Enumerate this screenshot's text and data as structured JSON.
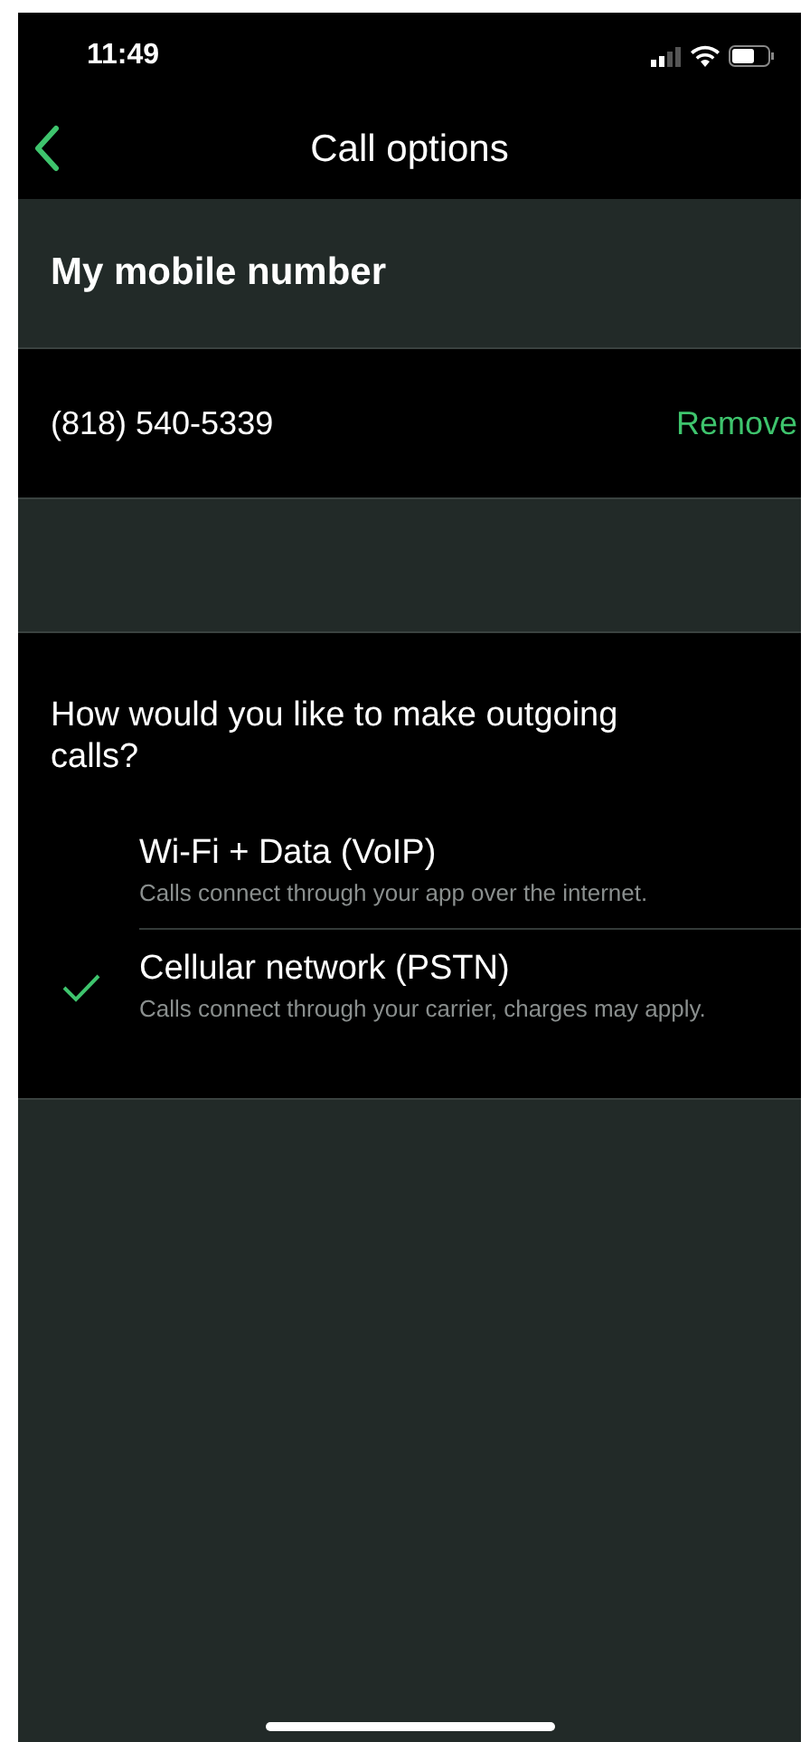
{
  "status_bar": {
    "time": "11:49"
  },
  "nav": {
    "title": "Call options"
  },
  "number_section": {
    "header": "My mobile number",
    "number": "(818) 540-5339",
    "action": "Remove"
  },
  "calls_section": {
    "question": "How would you like to make outgoing calls?",
    "options": [
      {
        "title": "Wi-Fi + Data (VoIP)",
        "description": "Calls connect through your app over the internet.",
        "selected": false
      },
      {
        "title": "Cellular network (PSTN)",
        "description": "Calls connect through your carrier, charges may apply.",
        "selected": true
      }
    ]
  }
}
